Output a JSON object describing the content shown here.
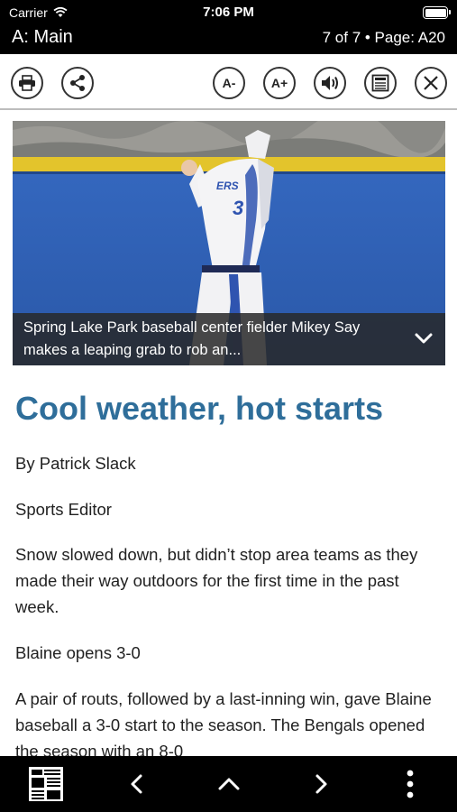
{
  "status_bar": {
    "carrier": "Carrier",
    "time": "7:06 PM"
  },
  "header": {
    "section": "A: Main",
    "page_info": "7 of 7 • Page: A20"
  },
  "toolbar": {
    "print_icon": "printer-icon",
    "share_icon": "share-icon",
    "font_smaller": "A-",
    "font_larger": "A+",
    "audio_icon": "speaker-icon",
    "text_view_icon": "article-text-icon",
    "close_icon": "close-icon"
  },
  "article": {
    "photo_caption": "Spring Lake Park baseball center fielder Mikey Say makes a leaping grab to rob an...",
    "jersey_text": "ERS",
    "jersey_number": "3",
    "headline": "Cool weather, hot starts",
    "byline": "By Patrick Slack",
    "role": "Sports Editor",
    "paragraph_1": "Snow slowed down, but didn’t stop area teams as they made their way outdoors for the first time in the past week.",
    "subhead_1": "Blaine opens 3-0",
    "paragraph_2": "A pair of routs, followed by a last-inning win, gave Blaine baseball a 3-0 start to the season. The Bengals opened the season with an 8-0"
  },
  "bottom_nav": {
    "newspaper_icon": "newspaper-icon",
    "prev_icon": "chevron-left-icon",
    "up_icon": "chevron-up-icon",
    "next_icon": "chevron-right-icon",
    "more_icon": "more-vertical-icon"
  },
  "colors": {
    "headline": "#2f6e9a",
    "bars": "#000000",
    "wall": "#2e5fb5",
    "wall_padding": "#e5c52a"
  }
}
